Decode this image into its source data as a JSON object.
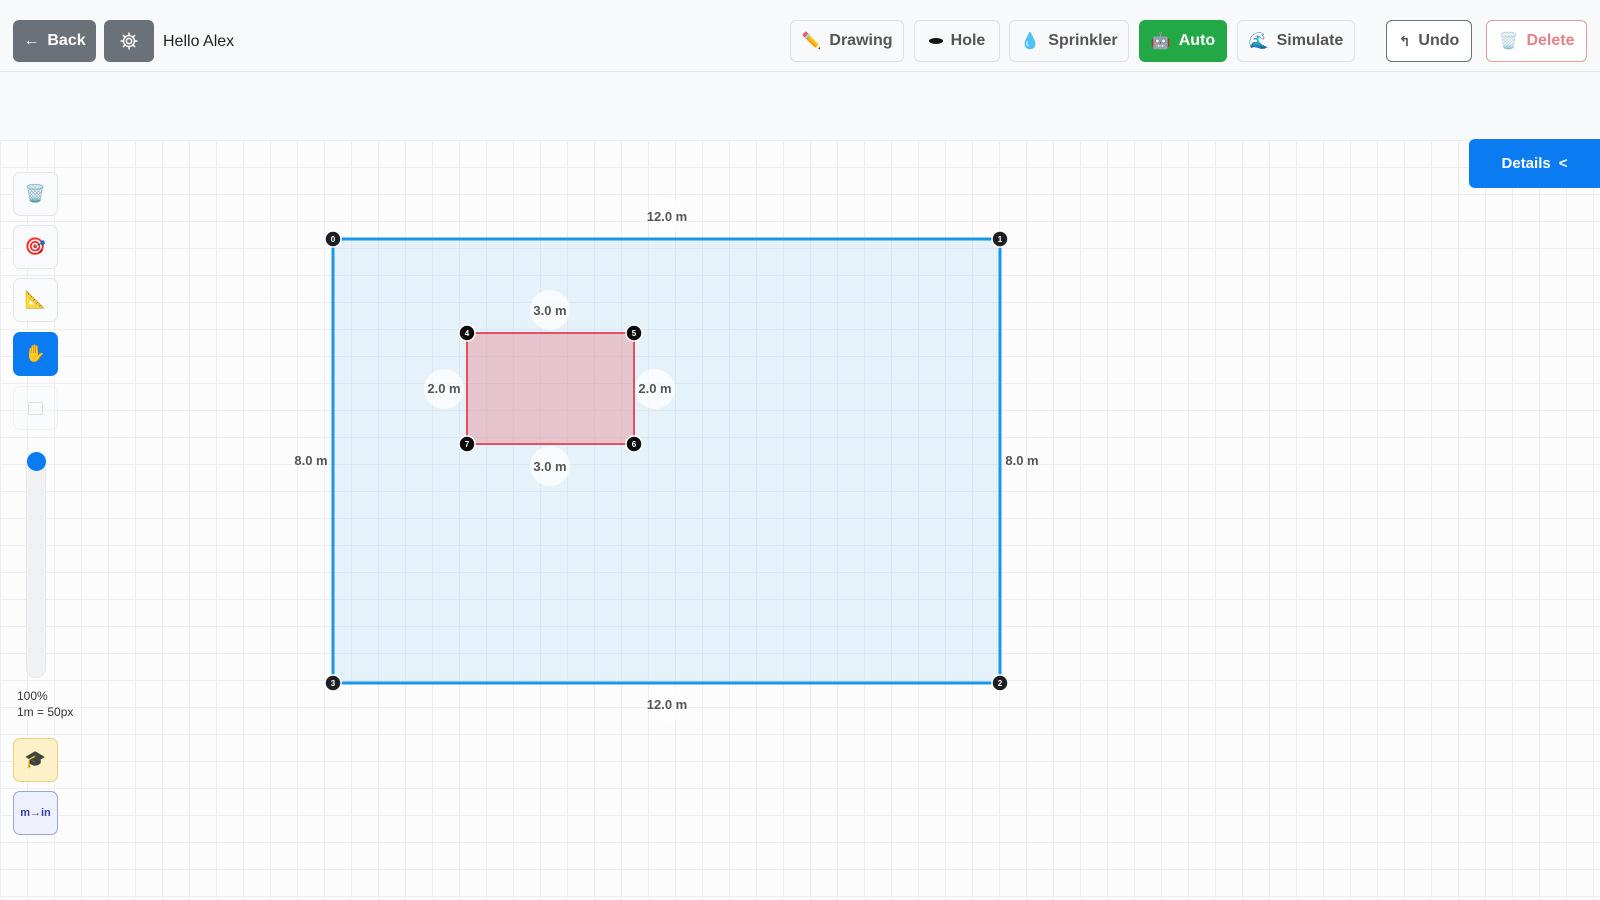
{
  "topbar": {
    "back_label": "Back",
    "greeting": "Hello Alex",
    "drawing_label": "Drawing",
    "hole_label": "Hole",
    "sprinkler_label": "Sprinkler",
    "auto_label": "Auto",
    "simulate_label": "Simulate",
    "undo_label": "Undo",
    "delete_label": "Delete"
  },
  "details_label": "Details",
  "toolbar": {
    "zoom": "100%",
    "scale": "1m = 50px",
    "unit_toggle": "m→in"
  },
  "area": {
    "vertices": [
      "0",
      "1",
      "2",
      "3"
    ],
    "top_len": "12.0 m",
    "bottom_len": "12.0 m",
    "left_len": "8.0 m",
    "right_len": "8.0 m"
  },
  "hole": {
    "vertices": [
      "4",
      "5",
      "6",
      "7"
    ],
    "top_len": "3.0 m",
    "bottom_len": "3.0 m",
    "left_len": "2.0 m",
    "right_len": "2.0 m"
  },
  "colors": {
    "accent": "#0b7bf2",
    "auto": "#22a845",
    "area_stroke": "#1a98e8",
    "hole_stroke": "#e0515c"
  }
}
